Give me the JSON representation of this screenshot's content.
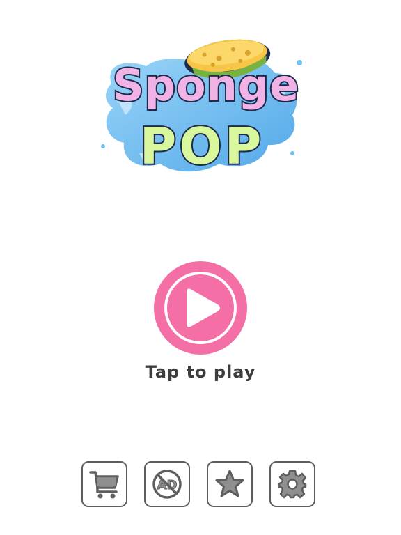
{
  "logo": {
    "line1": "Sponge",
    "line2": "POP"
  },
  "play": {
    "label": "Tap to play",
    "color": "#f46fa6"
  },
  "toolbar": [
    {
      "name": "shop",
      "icon": "shopping-cart-icon"
    },
    {
      "name": "remove-ads",
      "icon": "no-ads-icon",
      "icon_text": "AD"
    },
    {
      "name": "rate",
      "icon": "star-icon"
    },
    {
      "name": "settings",
      "icon": "gear-icon"
    }
  ],
  "colors": {
    "splash": "#4aa8e8",
    "sponge": "#f7c646",
    "icon_gray": "#5e5e5e",
    "icon_fill": "#8f8f8f",
    "label": "#3d3d3d"
  }
}
